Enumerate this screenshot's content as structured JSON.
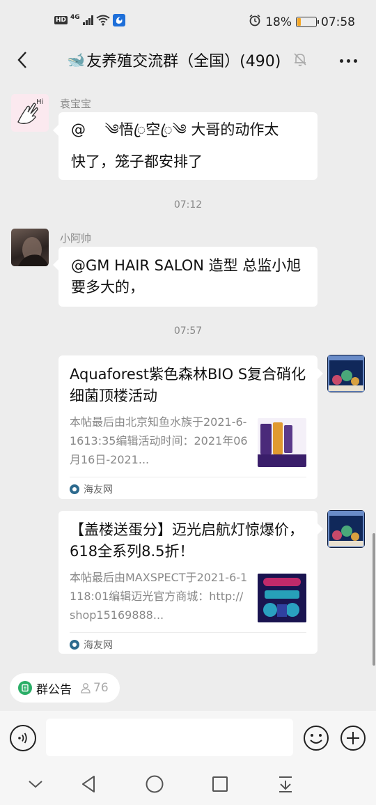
{
  "status_bar": {
    "left_badge": "HD",
    "network": "4G",
    "battery_text": "18%",
    "battery_level": 0.18,
    "time": "07:58"
  },
  "header": {
    "title_emoji": "🐋",
    "title": "友养殖交流群（全国）(490)"
  },
  "messages": [
    {
      "type": "text",
      "sender": "袁宝宝",
      "lines": [
        "@ 　༄悟ꦿ空ꦿ༄ 大哥的动作太",
        "快了，笼子都安排了"
      ]
    },
    {
      "type": "time",
      "text": "07:12"
    },
    {
      "type": "text",
      "sender": "小阿帅",
      "lines": [
        "@GM HAIR SALON 造型 总监小旭",
        "要多大的，"
      ]
    },
    {
      "type": "time",
      "text": "07:57"
    },
    {
      "type": "card",
      "title": "Aquaforest紫色森林BIO S复合硝化细菌顶楼活动",
      "desc": "本帖最后由北京知鱼水族于2021-6-1613:35编辑活动时间：2021年06月16日-2021...",
      "source": "海友网"
    },
    {
      "type": "card",
      "title": "【盖楼送蛋分】迈光启航灯惊爆价，618全系列8.5折！",
      "desc": "本帖最后由MAXSPECT于2021-6-1118:01编辑迈光官方商城：http://shop15169888...",
      "source": "海友网"
    }
  ],
  "notice": {
    "label": "群公告",
    "count": "76"
  },
  "input": {
    "placeholder": ""
  },
  "icons": {
    "back": "chevron-left-icon",
    "mute": "bell-off-icon",
    "more": "more-dots-icon",
    "voice": "voice-icon",
    "emoji": "emoji-icon",
    "plus": "plus-icon"
  },
  "colors": {
    "background": "#ededed",
    "bubble": "#ffffff",
    "notice_green": "#2aae67",
    "battery": "#f5a623"
  }
}
